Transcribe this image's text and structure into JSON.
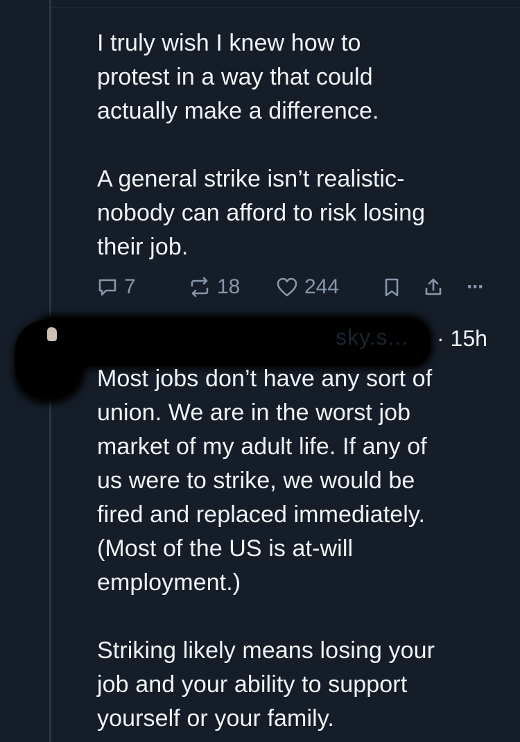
{
  "post1": {
    "text": "I truly wish I knew how to\nprotest in a way that could\nactually make a difference.\n\nA general strike isn’t realistic-\nnobody can afford to risk losing\ntheir job.",
    "reply_count": "7",
    "repost_count": "18",
    "like_count": "244",
    "more_label": "···",
    "icons": {
      "reply": "speech-bubble-icon",
      "repost": "repost-icon",
      "like": "heart-icon",
      "bookmark": "bookmark-icon",
      "share": "share-icon"
    }
  },
  "post2": {
    "handle_fragment": "sky.s...",
    "timestamp": "· 15h",
    "text": "Most jobs don’t have any sort of\nunion. We are in the worst job\nmarket of my adult life. If any of\nus were to strike, we would be\nfired and replaced immediately.\n(Most of the US is at-will\nemployment.)\n\nStriking likely means losing your\njob and your ability to support\nyourself or your family."
  },
  "colors": {
    "background": "#151d28",
    "text": "#f1f3f5",
    "muted": "#8796ab",
    "thread_line": "#2c3643",
    "redaction": "#000000"
  }
}
